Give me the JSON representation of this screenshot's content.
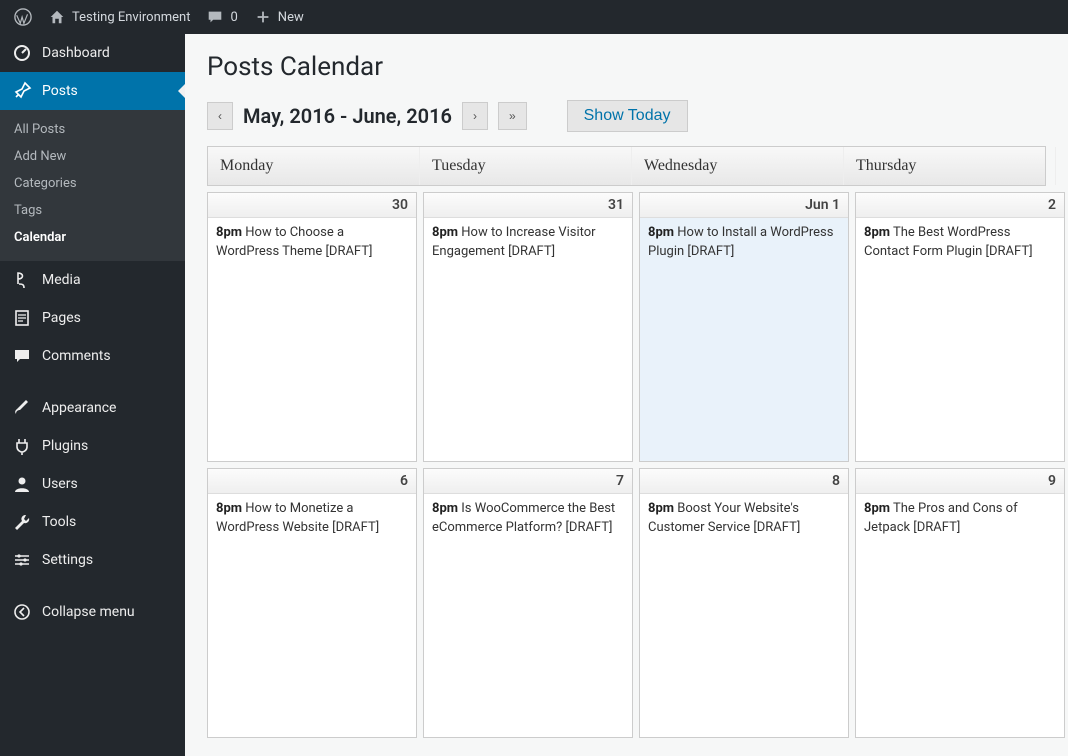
{
  "adminbar": {
    "site_title": "Testing Environment",
    "comments_count": "0",
    "new_label": "New"
  },
  "sidebar": {
    "dashboard": "Dashboard",
    "posts": "Posts",
    "posts_sub": {
      "all": "All Posts",
      "add": "Add New",
      "cats": "Categories",
      "tags": "Tags",
      "calendar": "Calendar"
    },
    "media": "Media",
    "pages": "Pages",
    "comments": "Comments",
    "appearance": "Appearance",
    "plugins": "Plugins",
    "users": "Users",
    "tools": "Tools",
    "settings": "Settings",
    "collapse": "Collapse menu"
  },
  "page": {
    "title": "Posts Calendar",
    "range": "May, 2016 - June, 2016",
    "prev": "‹",
    "next": "›",
    "ff": "»",
    "show_today": "Show Today"
  },
  "calendar": {
    "headers": {
      "mon": "Monday",
      "tue": "Tuesday",
      "wed": "Wednesday",
      "thu": "Thursday"
    },
    "rows": [
      {
        "cells": [
          {
            "date": "30",
            "time": "8pm",
            "title": "How to Choose a WordPress Theme [DRAFT]",
            "highlight": false
          },
          {
            "date": "31",
            "time": "8pm",
            "title": "How to Increase Visitor Engagement [DRAFT]",
            "highlight": false
          },
          {
            "date": "Jun 1",
            "time": "8pm",
            "title": "How to Install a WordPress Plugin [DRAFT]",
            "highlight": true
          },
          {
            "date": "2",
            "time": "8pm",
            "title": "The Best WordPress Contact Form Plugin [DRAFT]",
            "highlight": false
          }
        ]
      },
      {
        "cells": [
          {
            "date": "6",
            "time": "8pm",
            "title": "How to Monetize a WordPress Website [DRAFT]",
            "highlight": false
          },
          {
            "date": "7",
            "time": "8pm",
            "title": "Is WooCommerce the Best eCommerce Platform? [DRAFT]",
            "highlight": false
          },
          {
            "date": "8",
            "time": "8pm",
            "title": "Boost Your Website's Customer Service [DRAFT]",
            "highlight": false
          },
          {
            "date": "9",
            "time": "8pm",
            "title": "The Pros and Cons of Jetpack [DRAFT]",
            "highlight": false
          }
        ]
      }
    ]
  }
}
